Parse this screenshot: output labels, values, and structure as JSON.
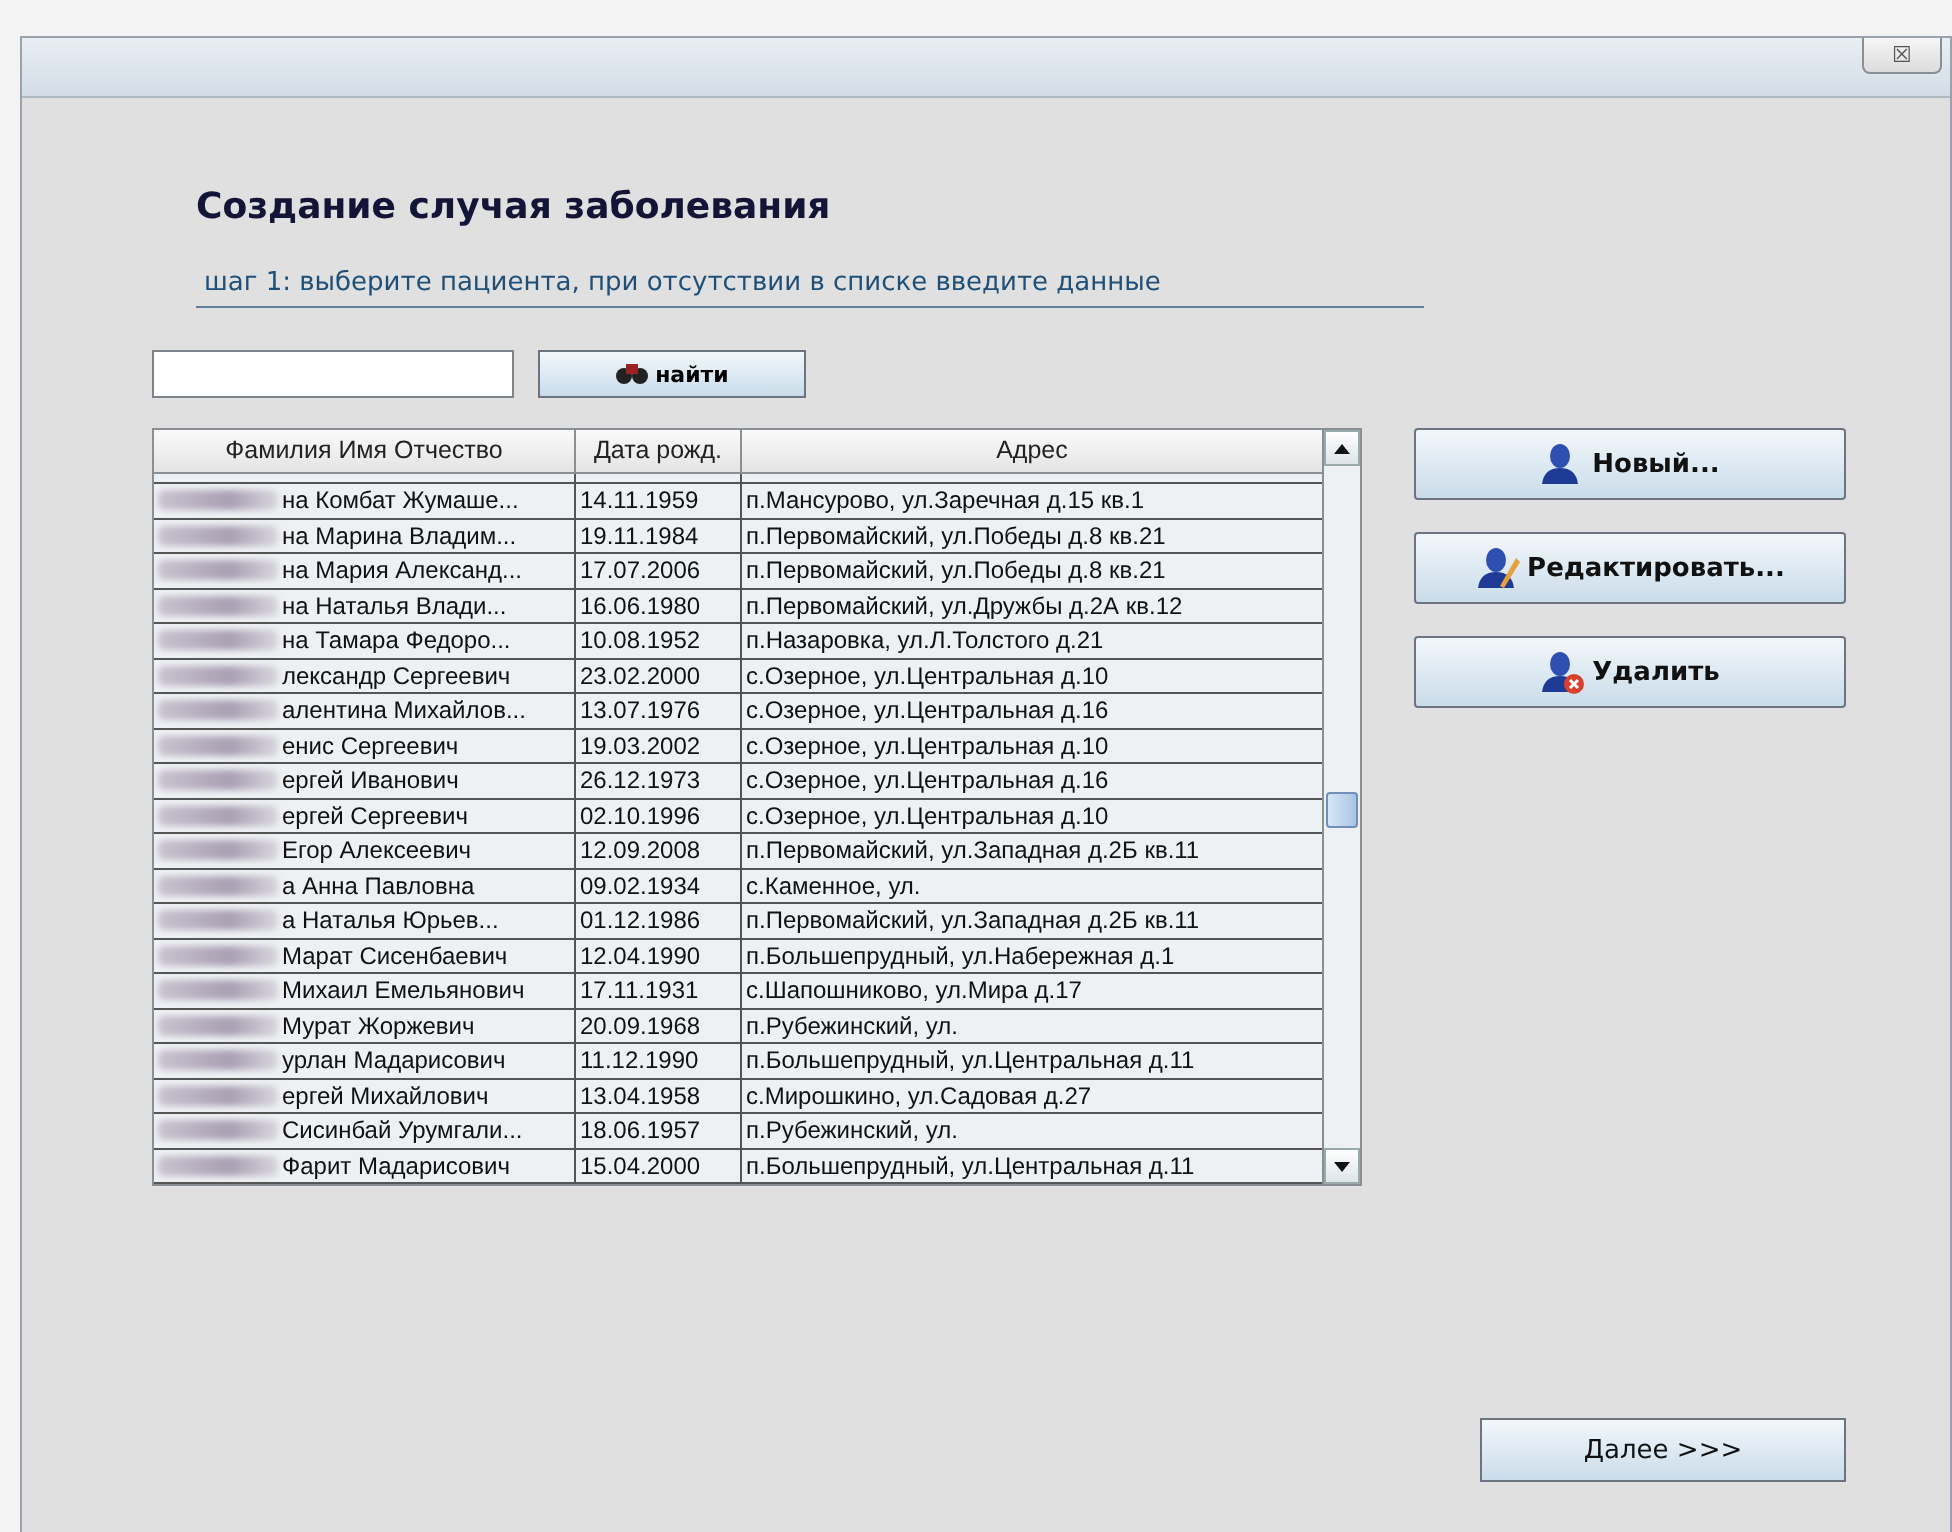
{
  "window": {
    "close": "☒"
  },
  "heading": "Создание случая заболевания",
  "step": "шаг 1: выберите пациента, при отсутствии в списке введите данные",
  "search": {
    "button": "найти"
  },
  "table": {
    "columns": [
      "Фамилия Имя Отчество",
      "Дата рожд.",
      "Адрес"
    ],
    "rows": [
      [
        "на Комбат Жумаше...",
        "14.11.1959",
        "п.Мансурово, ул.Заречная д.15 кв.1"
      ],
      [
        "на Марина Владим...",
        "19.11.1984",
        "п.Первомайский, ул.Победы д.8 кв.21"
      ],
      [
        "на Мария Александ...",
        "17.07.2006",
        "п.Первомайский, ул.Победы д.8 кв.21"
      ],
      [
        "на Наталья Влади...",
        "16.06.1980",
        "п.Первомайский, ул.Дружбы д.2А кв.12"
      ],
      [
        "на Тамара Федоро...",
        "10.08.1952",
        "п.Назаровка, ул.Л.Толстого д.21"
      ],
      [
        "лександр Сергеевич",
        "23.02.2000",
        "с.Озерное, ул.Центральная д.10"
      ],
      [
        "алентина Михайлов...",
        "13.07.1976",
        "с.Озерное, ул.Центральная д.16"
      ],
      [
        "енис Сергеевич",
        "19.03.2002",
        "с.Озерное, ул.Центральная д.10"
      ],
      [
        "ергей Иванович",
        "26.12.1973",
        "с.Озерное, ул.Центральная д.16"
      ],
      [
        "ергей Сергеевич",
        "02.10.1996",
        "с.Озерное, ул.Центральная д.10"
      ],
      [
        "Егор Алексеевич",
        "12.09.2008",
        "п.Первомайский, ул.Западная д.2Б кв.11"
      ],
      [
        "а Анна Павловна",
        "09.02.1934",
        "с.Каменное, ул."
      ],
      [
        "а Наталья Юрьев...",
        "01.12.1986",
        "п.Первомайский, ул.Западная д.2Б кв.11"
      ],
      [
        "Марат Сисенбаевич",
        "12.04.1990",
        "п.Большепрудный, ул.Набережная д.1"
      ],
      [
        "Михаил Емельянович",
        "17.11.1931",
        "с.Шапошниково, ул.Мира д.17"
      ],
      [
        "Мурат Жоржевич",
        "20.09.1968",
        "п.Рубежинский, ул."
      ],
      [
        "урлан Мадарисович",
        "11.12.1990",
        "п.Большепрудный, ул.Центральная д.11"
      ],
      [
        "ергей Михайлович",
        "13.04.1958",
        "с.Мирошкино, ул.Садовая д.27"
      ],
      [
        "Сисинбай Урумгали...",
        "18.06.1957",
        "п.Рубежинский, ул."
      ],
      [
        "Фарит Мадарисович",
        "15.04.2000",
        "п.Большепрудный, ул.Центральная д.11"
      ]
    ]
  },
  "actions": [
    {
      "kind": "new",
      "label": "Новый..."
    },
    {
      "kind": "edit",
      "label": "Редактировать..."
    },
    {
      "kind": "delete",
      "label": "Удалить"
    }
  ],
  "next_button": "Далее >>>"
}
